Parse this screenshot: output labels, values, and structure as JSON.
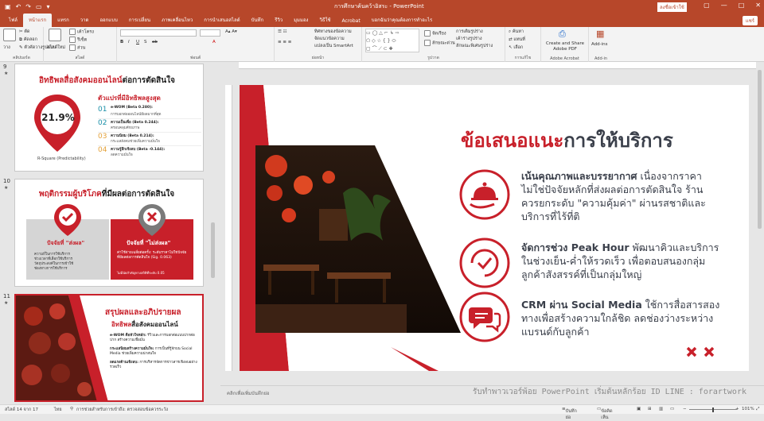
{
  "window": {
    "title": "การศึกษาค้นคว้าอิสระ  -  PowerPoint",
    "account": "ลงชื่อเข้าใช้",
    "share": "แชร์"
  },
  "tabs": [
    "ไฟล์",
    "หน้าแรก",
    "แทรก",
    "วาด",
    "ออกแบบ",
    "การเปลี่ยน",
    "ภาพเคลื่อนไหว",
    "การนำเสนอสไลด์",
    "บันทึก",
    "รีวิว",
    "มุมมอง",
    "วิธีใช้",
    "Acrobat",
    "บอกฉันว่าคุณต้องการทำอะไร"
  ],
  "ribbon": {
    "clipboard": {
      "paste": "วาง",
      "cut": "ตัด",
      "copy": "คัดลอก",
      "format": "ตัวคัดวางรูปแบบ",
      "label": "คลิปบอร์ด"
    },
    "slides": {
      "new": "สไลด์ใหม่",
      "layout": "เค้าโครง",
      "reset": "รีเซ็ต",
      "section": "ส่วน",
      "label": "สไลด์"
    },
    "font": {
      "label": "ฟอนต์"
    },
    "paragraph": {
      "direction": "ทิศทางของข้อความ",
      "align": "จัดแนวข้อความ",
      "smartart": "แปลงเป็น SmartArt",
      "label": "ย่อหน้า"
    },
    "drawing": {
      "arrange": "จัดเรียง",
      "quick": "ลักษณะด่วน",
      "fill": "การเติมรูปร่าง",
      "outline": "เค้าร่างรูปร่าง",
      "effects": "ลักษณะพิเศษรูปร่าง",
      "label": "รูปวาด"
    },
    "editing": {
      "find": "ค้นหา",
      "replace": "แทนที่",
      "select": "เลือก",
      "label": "การแก้ไข"
    },
    "acrobat": {
      "btn": "Create and Share Adobe PDF",
      "label": "Adobe Acrobat"
    },
    "addins": {
      "btn": "Add-ins",
      "label": "Add-in"
    }
  },
  "thumbs": [
    {
      "num": "9",
      "title_red": "อิทธิพลสื่อสังคมออนไลน์",
      "title_dark": "ต่อการตัดสินใจ",
      "circle_value": "21.9%",
      "circle_caption": "R-Square (Predictability)",
      "subtitle": "ตัวแปรที่มีอิทธิพลสูงสุด",
      "factors": [
        {
          "n": "01",
          "name": "e-WOM (Beta 0.280):",
          "desc": "การบอกต่อออนไลน์มีผลมากที่สุด"
        },
        {
          "n": "02",
          "name": "ความเป็นเพื่อ (Beta 0.244):",
          "desc": "ครอบคลุมศักยภาพ"
        },
        {
          "n": "03",
          "name": "ความนิยม (Beta 0.214):",
          "desc": "กระแสสังคมช่วยเพิ่มความมั่นใจ"
        },
        {
          "n": "04",
          "name": "ความรู้สึกเชิงลบ (Beta -0.144):",
          "desc": "ลดความมั่นใจ"
        }
      ]
    },
    {
      "num": "10",
      "title_red": "พฤติกรรมผู้บริโภค",
      "title_dark": "ที่มีผลต่อการตัดสินใจ",
      "left_label": "ปัจจัยที่ \"ส่งผล\"",
      "right_label": "ปัจจัยที่ \"ไม่ส่งผล\"",
      "left_items": [
        "ความถี่ในการใช้บริการ",
        "ช่วงเวลาที่เลือกใช้บริการ",
        "วัตถุประสงค์ในการเข้าใช้",
        "ช่องทางการใช้บริการ"
      ],
      "right_items": [
        "ค่าใช้จ่ายเฉลี่ยต่อครั้ง: ระดับราคาไม่ใช่ปัจจัยที่มีผลต่อการตัดสินใจ (Sig. 0.063)"
      ],
      "note": "ไม่มีนัยสำคัญทางสถิติที่ระดับ 0.05"
    },
    {
      "num": "11",
      "title_red": "สรุปผลและอภิปรายผล",
      "subtitle_red": "อิทธิพล",
      "subtitle_dark": "สื่อสังคมออนไลน์",
      "bullets": [
        {
          "title": "e-WOM คือหัวใจหลัก:",
          "desc": "รีวิวและการบอกต่อแบบปากต่อปาก สร้างความเชื่อมั่น"
        },
        {
          "title": "กระแสนิยมสร้างความมั่นใจ:",
          "desc": "การเป็นที่รู้จักบน Social Media ช่วยเพิ่มความน่าสนใจ"
        },
        {
          "title": "ลดแรงต้านเชิงลบ:",
          "desc": "การบริหารจัดการข่าวสารเชิงลบอย่างรวดเร็ว"
        }
      ]
    }
  ],
  "slide": {
    "title_red": "ข้อเสนอแนะ",
    "title_dark": "การให้บริการ",
    "items": [
      {
        "icon": "service-bell-icon",
        "lines": [
          "เน้นคุณภาพและบรรยากาศ เนื่องจากราคา",
          "ไม่ใช่ปัจจัยหลักที่ส่งผลต่อการตัดสินใจ ร้าน",
          "ควรยกระดับ \"ความคุ้มค่า\" ผ่านรสชาติและ",
          "บริการที่ไร้ที่ติ"
        ],
        "bold": "เน้นคุณภาพและบรรยากาศ"
      },
      {
        "icon": "clock-check-icon",
        "lines": [
          "จัดการช่วง Peak Hour พัฒนาคิวและบริการ",
          "ในช่วงเย็น-ค่ำให้รวดเร็ว เพื่อตอบสนองกลุ่ม",
          "ลูกค้าสังสรรค์ที่เป็นกลุ่มใหญ่"
        ],
        "bold": "จัดการช่วง Peak Hour"
      },
      {
        "icon": "chat-bubbles-icon",
        "lines": [
          "CRM ผ่าน Social Media ใช้การสื่อสารสอง",
          "ทางเพื่อสร้างความใกล้ชิด ลดช่องว่างระหว่าง",
          "แบรนด์กับลูกค้า"
        ],
        "bold": "CRM ผ่าน Social Media"
      }
    ],
    "accent": "#c8202a"
  },
  "notes": {
    "placeholder": "คลิกเพื่อเพิ่มบันทึกย่อ",
    "watermark": "รับทำพาวเวอร์พ้อย PowerPoint เริ่มต้นหลักร้อย ID LINE : forartwork"
  },
  "status": {
    "slide": "สไลด์ 14 จาก 17",
    "lang": "ไทย",
    "a11y": "การช่วยสำหรับการเข้าถึง: ตรวจสอบข้อควรระวัง",
    "notes": "บันทึกย่อ",
    "comments": "ข้อคิดเห็น",
    "zoom": "101%"
  }
}
